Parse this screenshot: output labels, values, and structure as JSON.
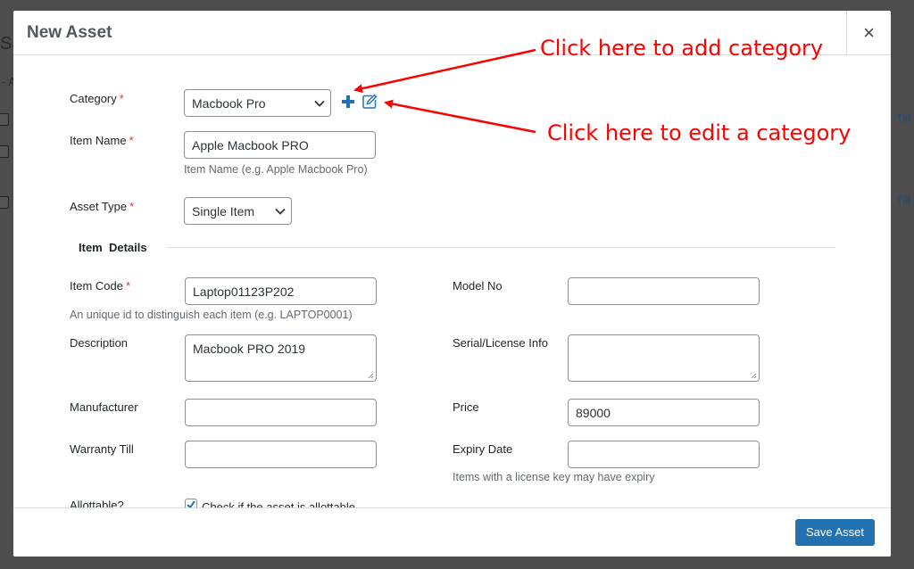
{
  "modal": {
    "title": "New Asset",
    "close_glyph": "×"
  },
  "background": {
    "left_fragment_1": "SS",
    "left_fragment_2": "- A",
    "right_fragment": "Till"
  },
  "form": {
    "category": {
      "label": "Category",
      "required_mark": "*",
      "value": "Macbook Pro"
    },
    "item_name": {
      "label": "Item Name",
      "required_mark": "*",
      "value": "Apple Macbook PRO",
      "hint": "Item Name (e.g. Apple Macbook Pro)"
    },
    "asset_type": {
      "label": "Asset Type",
      "required_mark": "*",
      "value": "Single Item"
    },
    "section_title": "Item  Details",
    "item_code": {
      "label": "Item Code",
      "required_mark": "*",
      "value": "Laptop01123P202",
      "hint": "An unique id to distinguish each item (e.g. LAPTOP0001)"
    },
    "model_no": {
      "label": "Model No",
      "value": ""
    },
    "description": {
      "label": "Description",
      "value": "Macbook PRO 2019"
    },
    "serial_license": {
      "label": "Serial/License Info",
      "value": ""
    },
    "manufacturer": {
      "label": "Manufacturer",
      "value": ""
    },
    "price": {
      "label": "Price",
      "value": "89000"
    },
    "warranty_till": {
      "label": "Warranty Till",
      "value": ""
    },
    "expiry_date": {
      "label": "Expiry Date",
      "value": "",
      "hint": "Items with a license key may have expiry"
    },
    "allottable": {
      "label": "Allottable?",
      "checkbox_label": "Check if the asset is allottable",
      "checked": true
    }
  },
  "footer": {
    "save_label": "Save Asset"
  },
  "annotations": {
    "add_category": "Click here to add category",
    "edit_category": "Click here to edit a category",
    "color": "#ff0000"
  },
  "colors": {
    "primary_button": "#2271b1",
    "required": "#d63638",
    "icon": "#2271b1"
  },
  "icons": {
    "add": "plus-icon",
    "edit": "edit-icon",
    "close": "close-icon",
    "dropdown": "chevron-down-icon"
  }
}
